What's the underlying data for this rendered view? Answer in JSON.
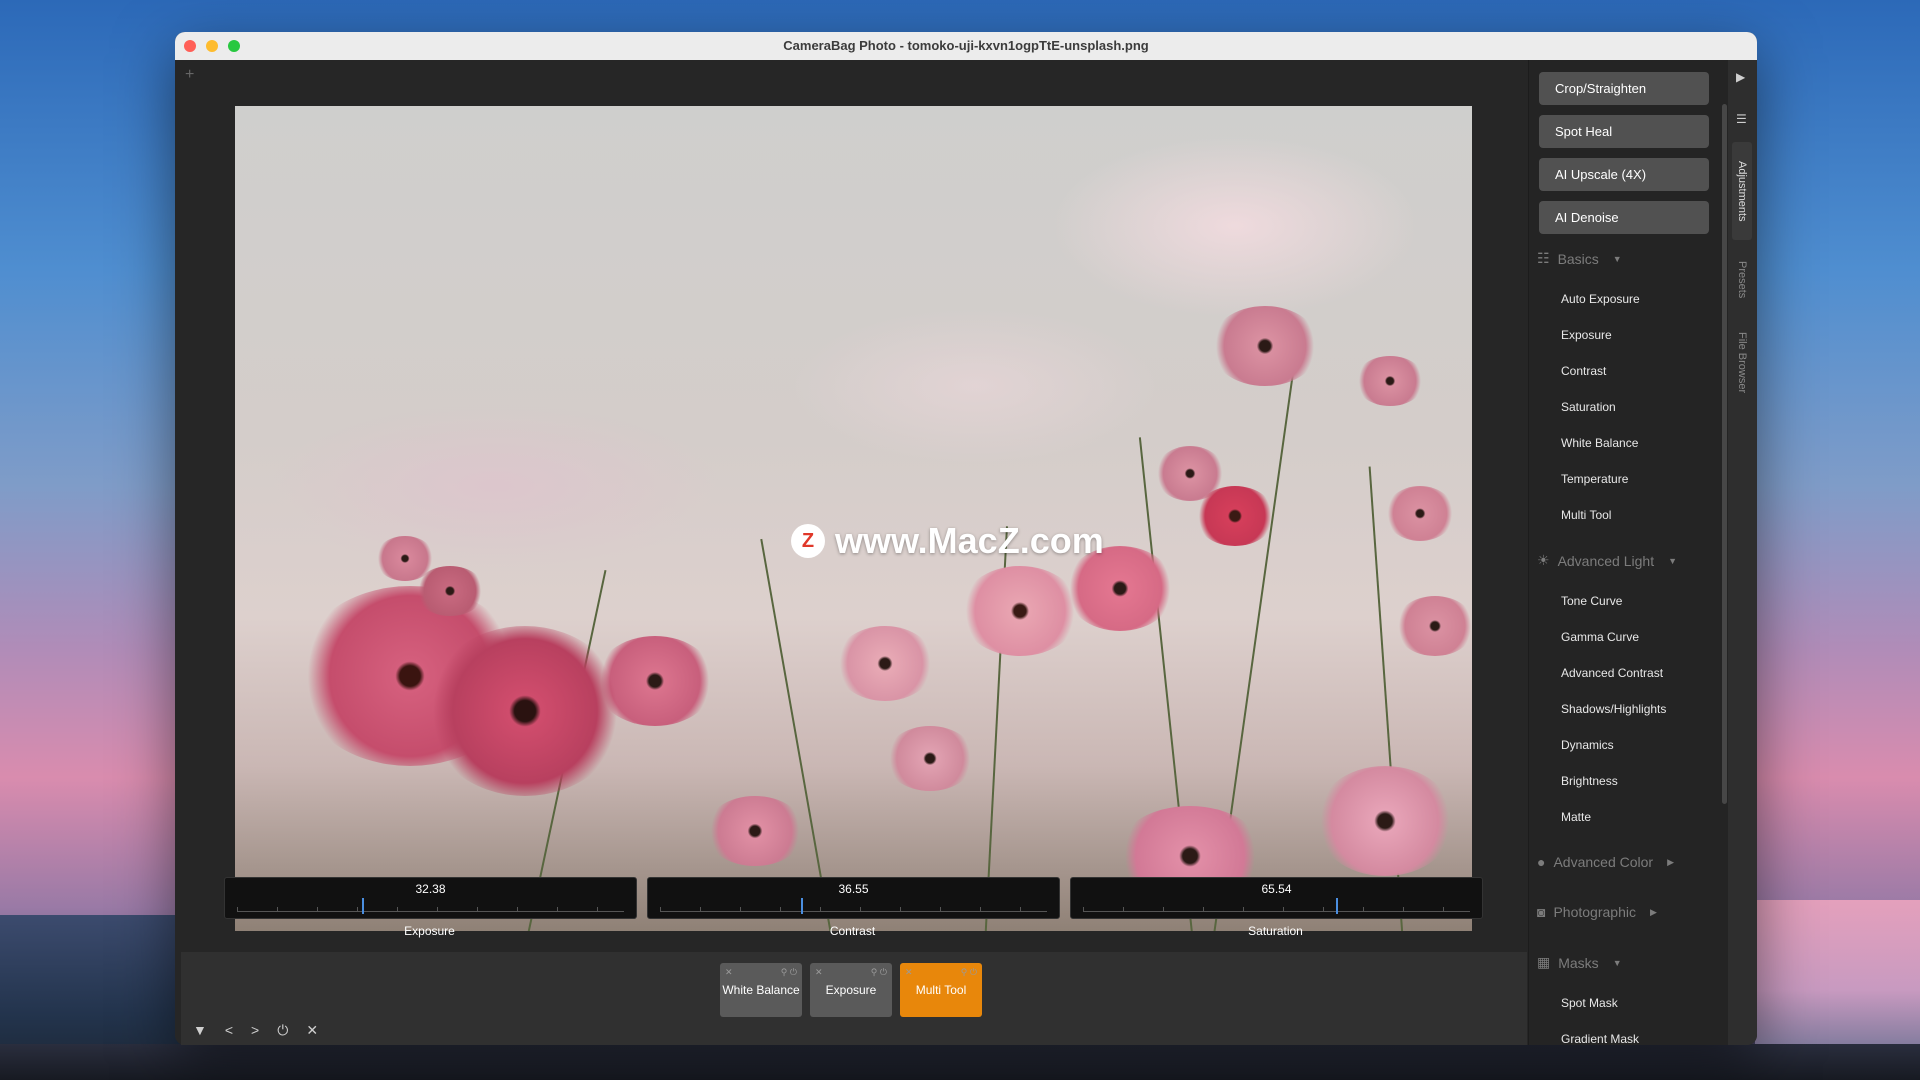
{
  "window": {
    "title": "CameraBag Photo - tomoko-uji-kxvn1ogpTtE-unsplash.png"
  },
  "editor": {
    "new_tab_icon": "plus-icon"
  },
  "watermark": {
    "text": "www.MacZ.com",
    "logo_letter": "Z"
  },
  "sliders": [
    {
      "label": "Exposure",
      "value": "32.38",
      "fraction": 0.323
    },
    {
      "label": "Contrast",
      "value": "36.55",
      "fraction": 0.365
    },
    {
      "label": "Saturation",
      "value": "65.54",
      "fraction": 0.655
    }
  ],
  "adjustment_stack": [
    {
      "label": "White Balance",
      "active": false
    },
    {
      "label": "Exposure",
      "active": false
    },
    {
      "label": "Multi Tool",
      "active": true
    }
  ],
  "bottom_controls": [
    "triangle-down-icon",
    "back-icon",
    "forward-icon",
    "power-icon",
    "close-icon"
  ],
  "panel": {
    "tools": [
      "Crop/Straighten",
      "Spot Heal",
      "AI Upscale (4X)",
      "AI Denoise"
    ],
    "sections": [
      {
        "title": "Basics",
        "expanded": true,
        "items": [
          "Auto Exposure",
          "Exposure",
          "Contrast",
          "Saturation",
          "White Balance",
          "Temperature",
          "Multi Tool"
        ]
      },
      {
        "title": "Advanced Light",
        "expanded": true,
        "items": [
          "Tone Curve",
          "Gamma Curve",
          "Advanced Contrast",
          "Shadows/Highlights",
          "Dynamics",
          "Brightness",
          "Matte"
        ]
      },
      {
        "title": "Advanced Color",
        "expanded": false,
        "items": []
      },
      {
        "title": "Photographic",
        "expanded": false,
        "items": []
      },
      {
        "title": "Masks",
        "expanded": true,
        "items": [
          "Spot Mask",
          "Gradient Mask"
        ]
      }
    ]
  },
  "rail": {
    "tabs": [
      "Adjustments",
      "Presets",
      "File Browser"
    ],
    "active_tab": "Adjustments"
  },
  "colors": {
    "accent": "#e8870b",
    "slider_marker": "#4a8ee0"
  }
}
